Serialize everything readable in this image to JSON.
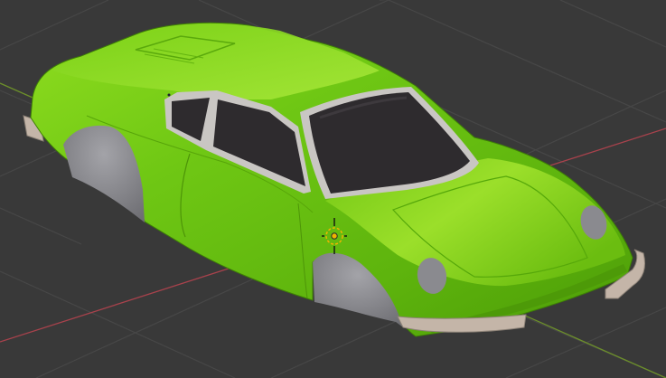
{
  "viewport": {
    "background_color": "#393939",
    "grid_color": "#4a4a4a",
    "x_axis_color": "#a8424c",
    "y_axis_color": "#6c8f2a"
  },
  "model": {
    "object": "car-body",
    "body_color": "#6fc714",
    "body_highlight_color": "#a6ea3b",
    "body_shadow_color": "#3f8a06",
    "glass_color": "#2e2b2e",
    "trim_color": "#c9c6c3",
    "wheel_arch_color": "#8d8d92",
    "bumper_color": "#c4b5a8"
  },
  "gizmo": {
    "icon": "object-origin-icon",
    "color": "#f0b400"
  }
}
